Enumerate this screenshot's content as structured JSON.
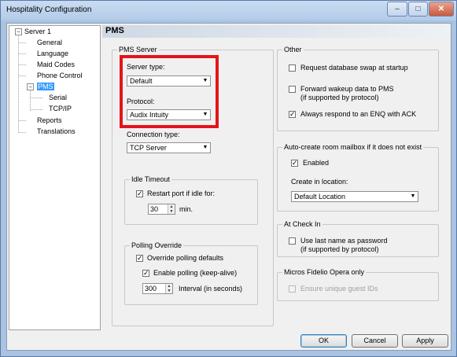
{
  "window": {
    "title": "Hospitality Configuration",
    "minimize": "–",
    "maximize": "□",
    "close": "✕"
  },
  "tree": {
    "items": [
      {
        "label": "Server 1"
      },
      {
        "label": "General"
      },
      {
        "label": "Language"
      },
      {
        "label": "Maid Codes"
      },
      {
        "label": "Phone Control"
      },
      {
        "label": "PMS"
      },
      {
        "label": "Serial"
      },
      {
        "label": "TCP/IP"
      },
      {
        "label": "Reports"
      },
      {
        "label": "Translations"
      }
    ],
    "toggle_minus": "−"
  },
  "header": {
    "title": "PMS"
  },
  "pms_server": {
    "group_title": "PMS Server",
    "server_type_label": "Server type:",
    "server_type_value": "Default",
    "protocol_label": "Protocol:",
    "protocol_value": "Audix Intuity",
    "connection_type_label": "Connection type:",
    "connection_type_value": "TCP Server",
    "dropdown_arrow": "▼"
  },
  "idle_timeout": {
    "group_title": "Idle Timeout",
    "restart_label": "Restart port if idle for:",
    "restart_checked": "✓",
    "minutes_value": "30",
    "minutes_unit": "min.",
    "spin_up": "▲",
    "spin_down": "▼"
  },
  "polling_override": {
    "group_title": "Polling Override",
    "override_label": "Override polling defaults",
    "override_checked": "✓",
    "enable_label": "Enable polling (keep-alive)",
    "enable_checked": "✓",
    "interval_value": "300",
    "interval_label": "Interval (in seconds)"
  },
  "other": {
    "group_title": "Other",
    "db_swap_label": "Request database swap at startup",
    "wakeup_label": "Forward wakeup data to PMS",
    "wakeup_sub": "(if supported by protocol)",
    "enq_label": "Always respond to an ENQ with ACK",
    "enq_checked": "✓"
  },
  "auto_create": {
    "group_title": "Auto-create room mailbox if it does not exist",
    "enabled_label": "Enabled",
    "enabled_checked": "✓",
    "location_label": "Create in location:",
    "location_value": "Default Location"
  },
  "check_in": {
    "group_title": "At Check In",
    "last_name_label": "Use last name as password",
    "last_name_sub": "(if supported by protocol)"
  },
  "opera": {
    "group_title": "Micros Fidelio Opera only",
    "unique_label": "Ensure unique guest IDs"
  },
  "buttons": {
    "ok": "OK",
    "cancel": "Cancel",
    "apply": "Apply"
  }
}
